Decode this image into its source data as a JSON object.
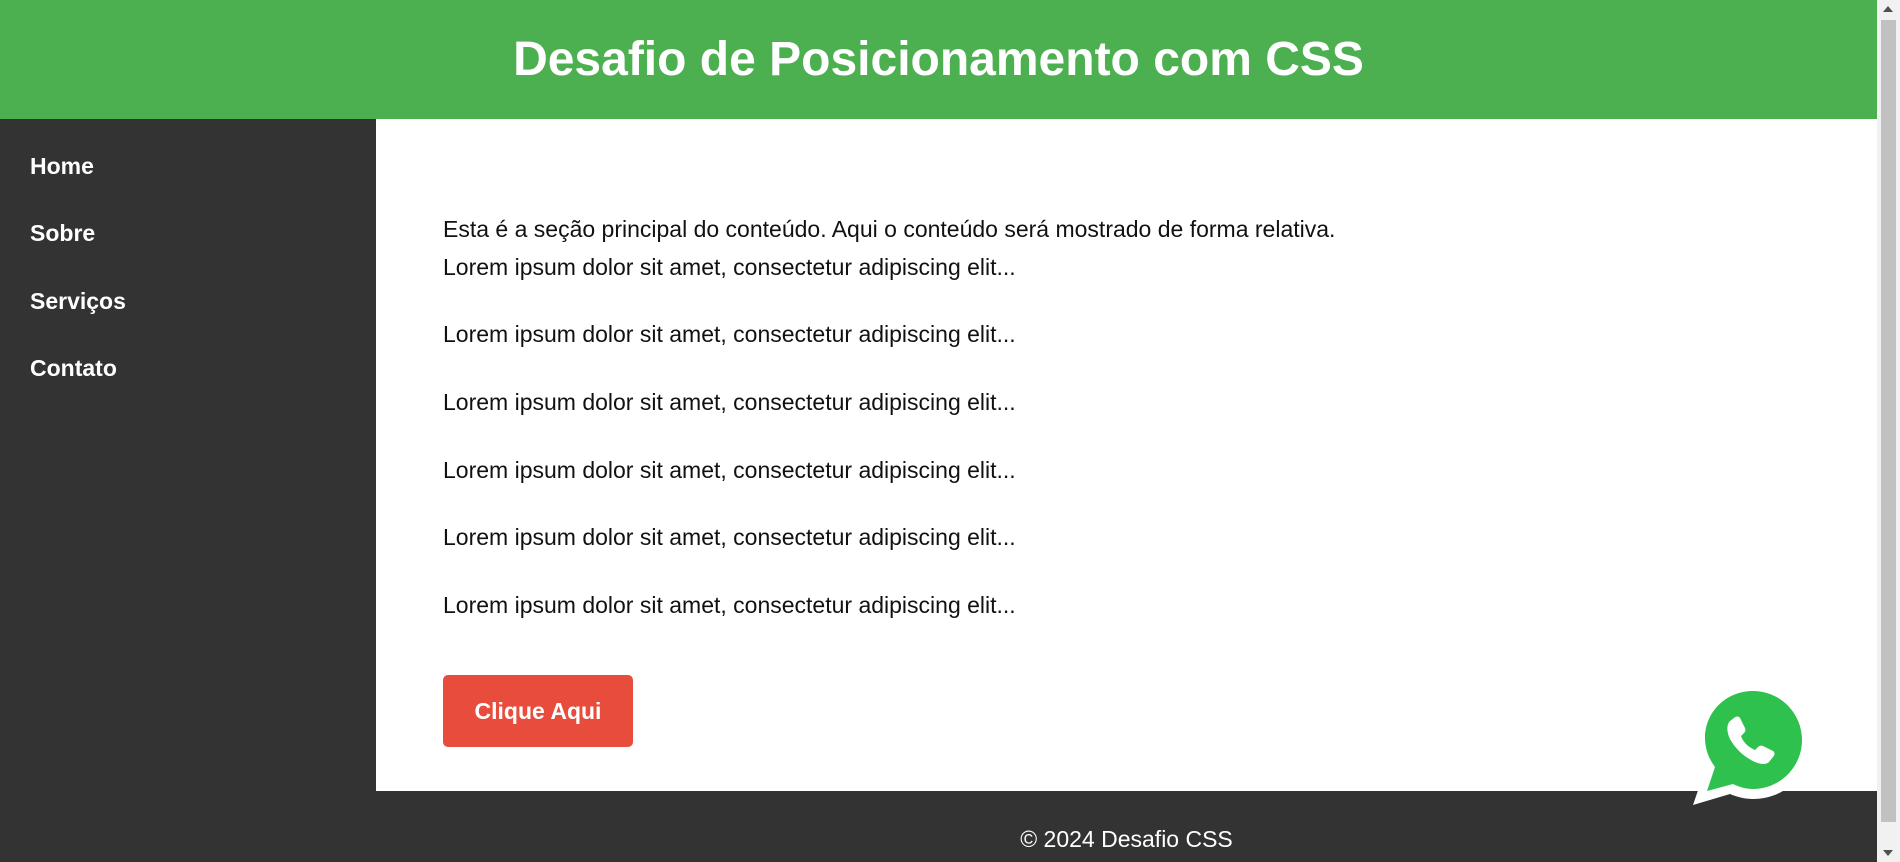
{
  "header": {
    "title": "Desafio de Posicionamento com CSS"
  },
  "sidebar": {
    "items": [
      {
        "label": "Home"
      },
      {
        "label": "Sobre"
      },
      {
        "label": "Serviços"
      },
      {
        "label": "Contato"
      }
    ]
  },
  "main": {
    "paragraphs": [
      "Esta é a seção principal do conteúdo. Aqui o conteúdo será mostrado de forma relativa.",
      "Lorem ipsum dolor sit amet, consectetur adipiscing elit...",
      "Lorem ipsum dolor sit amet, consectetur adipiscing elit...",
      "Lorem ipsum dolor sit amet, consectetur adipiscing elit...",
      "Lorem ipsum dolor sit amet, consectetur adipiscing elit...",
      "Lorem ipsum dolor sit amet, consectetur adipiscing elit...",
      "Lorem ipsum dolor sit amet, consectetur adipiscing elit..."
    ],
    "button_label": "Clique Aqui"
  },
  "footer": {
    "text": "© 2024 Desafio CSS"
  },
  "floating": {
    "icon": "whatsapp-icon"
  },
  "colors": {
    "header_bg": "#4caf50",
    "sidebar_bg": "#333333",
    "button_bg": "#e74c3c",
    "whatsapp_green": "#25d366"
  }
}
